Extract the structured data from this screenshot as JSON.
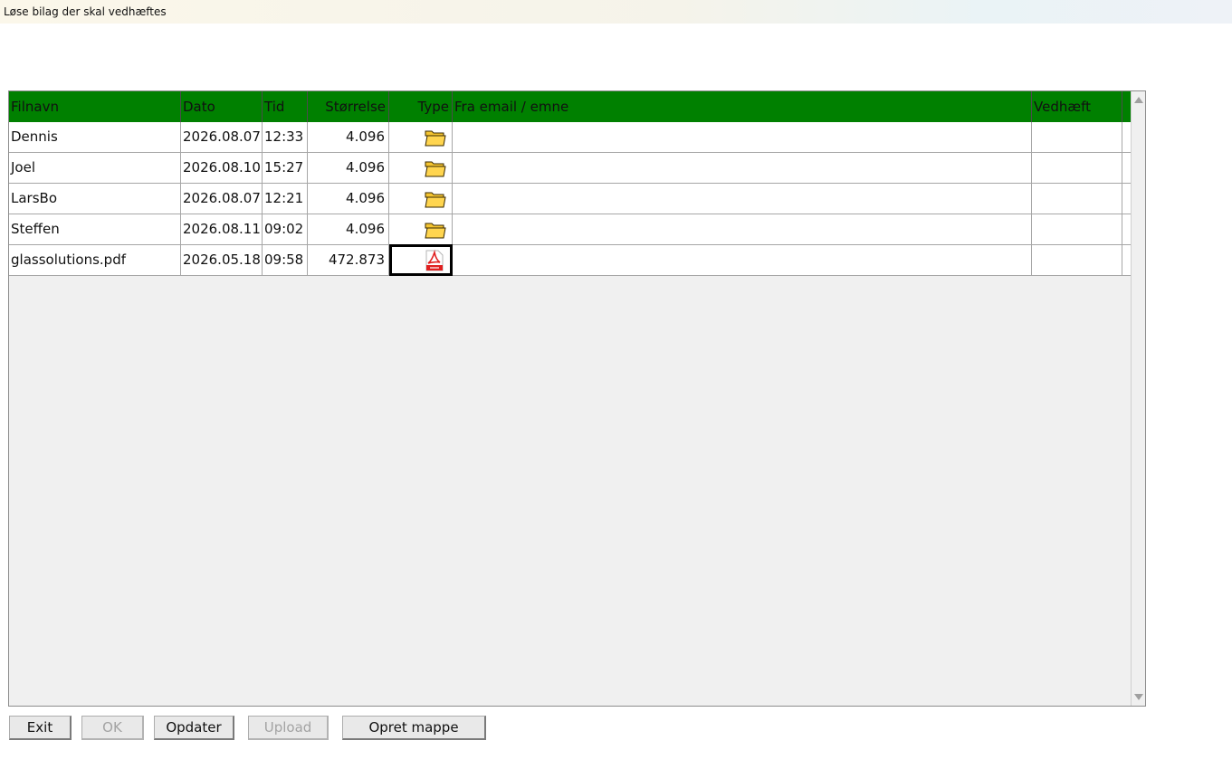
{
  "window": {
    "title": "Løse bilag der skal vedhæftes"
  },
  "table": {
    "columns": [
      "Filnavn",
      "Dato",
      "Tid",
      "Størrelse",
      "Type",
      "Fra email / emne",
      "Vedhæft"
    ],
    "rows": [
      {
        "name": "Dennis",
        "date": "2026.08.07",
        "time": "12:33",
        "size": "4.096",
        "type": "folder-icon",
        "from": "",
        "attach": ""
      },
      {
        "name": "Joel",
        "date": "2026.08.10",
        "time": "15:27",
        "size": "4.096",
        "type": "folder-icon",
        "from": "",
        "attach": ""
      },
      {
        "name": "LarsBo",
        "date": "2026.08.07",
        "time": "12:21",
        "size": "4.096",
        "type": "folder-icon",
        "from": "",
        "attach": ""
      },
      {
        "name": "Steffen",
        "date": "2026.08.11",
        "time": "09:02",
        "size": "4.096",
        "type": "folder-icon",
        "from": "",
        "attach": ""
      },
      {
        "name": "glassolutions.pdf",
        "date": "2026.05.18",
        "time": "09:58",
        "size": "472.873",
        "type": "pdf-icon",
        "from": "",
        "attach": ""
      }
    ],
    "header_color": "#008000",
    "selected_row": 4
  },
  "buttons": {
    "exit": "Exit",
    "ok": "OK",
    "update": "Opdater",
    "upload": "Upload",
    "create_folder": "Opret mappe"
  }
}
